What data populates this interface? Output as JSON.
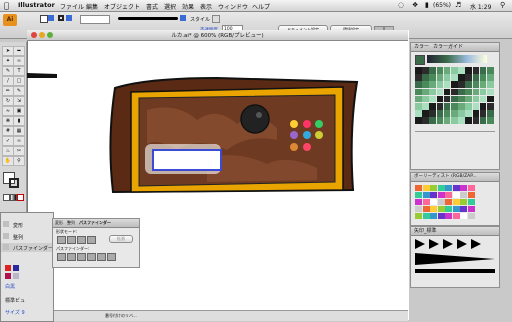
{
  "menubar": {
    "app_name": "Illustrator",
    "menus": [
      "ファイル",
      "編集",
      "オブジェクト",
      "書式",
      "選択",
      "効果",
      "表示",
      "ウィンドウ",
      "ヘルプ"
    ],
    "battery": "(65%)",
    "clock": "水 1:29"
  },
  "controlbar": {
    "ai_logo": "Ai",
    "style_label": "スタイル",
    "opacity_label": "不透明度",
    "opacity_value": "100",
    "doc_setup_button": "ドキュメント設定",
    "env_button": "環境設定"
  },
  "document": {
    "title": "ルカ.ai* @ 600% (RGB/プレビュー)",
    "zoom": "600%",
    "status": "番号付けのリバ..."
  },
  "panels": {
    "color_tab": "カラー",
    "color_guide_tab": "カラーガイド",
    "swatch_library_title": "ボーリーディスト (RGB/ZAP...",
    "arrow_panel_title": "矢印_標準"
  },
  "left_panel": {
    "items": [
      "変形",
      "整列",
      "パスファインダー"
    ],
    "labels": [
      "白黒",
      "標準ビュ",
      "サイズ 9"
    ]
  },
  "pathfinder": {
    "tabs": [
      "変形",
      "整列",
      "パスファインダー"
    ],
    "shape_mode_label": "形状モード:",
    "expand_button": "拡張",
    "pathfinder_label": "パスファインダー:"
  },
  "colors": {
    "frame_dark": "#5a2a14",
    "frame_mid": "#7a3a1c",
    "gold": "#e9a400",
    "inner_bg": "#6e3b22",
    "screen_border": "#3a4bd6"
  },
  "artwork_dots": [
    "#ffcc33",
    "#ff3366",
    "#33cc66",
    "#9966cc",
    "#33aadd",
    "#cccc33",
    "#dd8833",
    "#ff4466"
  ]
}
